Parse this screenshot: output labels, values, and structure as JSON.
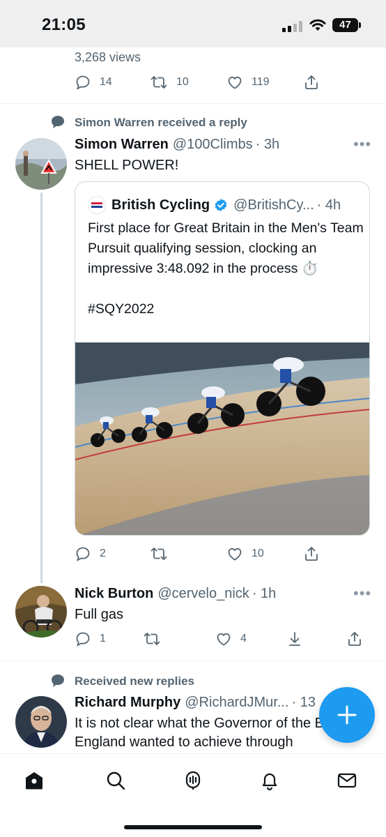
{
  "status_bar": {
    "time": "21:05",
    "battery": "47"
  },
  "top_tweet": {
    "views": "3,268 views",
    "actions": {
      "reply": "14",
      "retweet": "10",
      "like": "119"
    }
  },
  "reply_tweet": {
    "social_context": "Simon Warren received a reply",
    "name": "Simon Warren",
    "handle": "@100Climbs",
    "time": "· 3h",
    "text": "SHELL POWER!",
    "more": "•••",
    "quote": {
      "logo_text": "BRITISH CYCLING",
      "name": "British Cycling",
      "handle": "@BritishCy...",
      "time": "· 4h",
      "text": "First place for Great Britain in the Men's Team Pursuit qualifying session, clocking an impressive 3:48.092 in the process ⏱️\n\n#SQY2022"
    },
    "actions": {
      "reply": "2",
      "retweet": "",
      "like": "10"
    }
  },
  "second_tweet": {
    "name": "Nick Burton",
    "handle": "@cervelo_nick",
    "time": "· 1h",
    "text": "Full gas",
    "more": "•••",
    "actions": {
      "reply": "1",
      "retweet": "",
      "like": "4"
    }
  },
  "third_tweet": {
    "social_context": "Received new replies",
    "name": "Richard Murphy",
    "handle": "@RichardJMur...",
    "time": "· 13",
    "text": "It is not clear what the Governor of the Bank of England wanted to achieve through"
  },
  "tabbar": {
    "items": [
      "home-icon",
      "search-icon",
      "spaces-icon",
      "notifications-icon",
      "messages-icon"
    ]
  },
  "colors": {
    "accent": "#1d9bf0",
    "verified": "#1d9bf0",
    "muted": "#536471"
  }
}
